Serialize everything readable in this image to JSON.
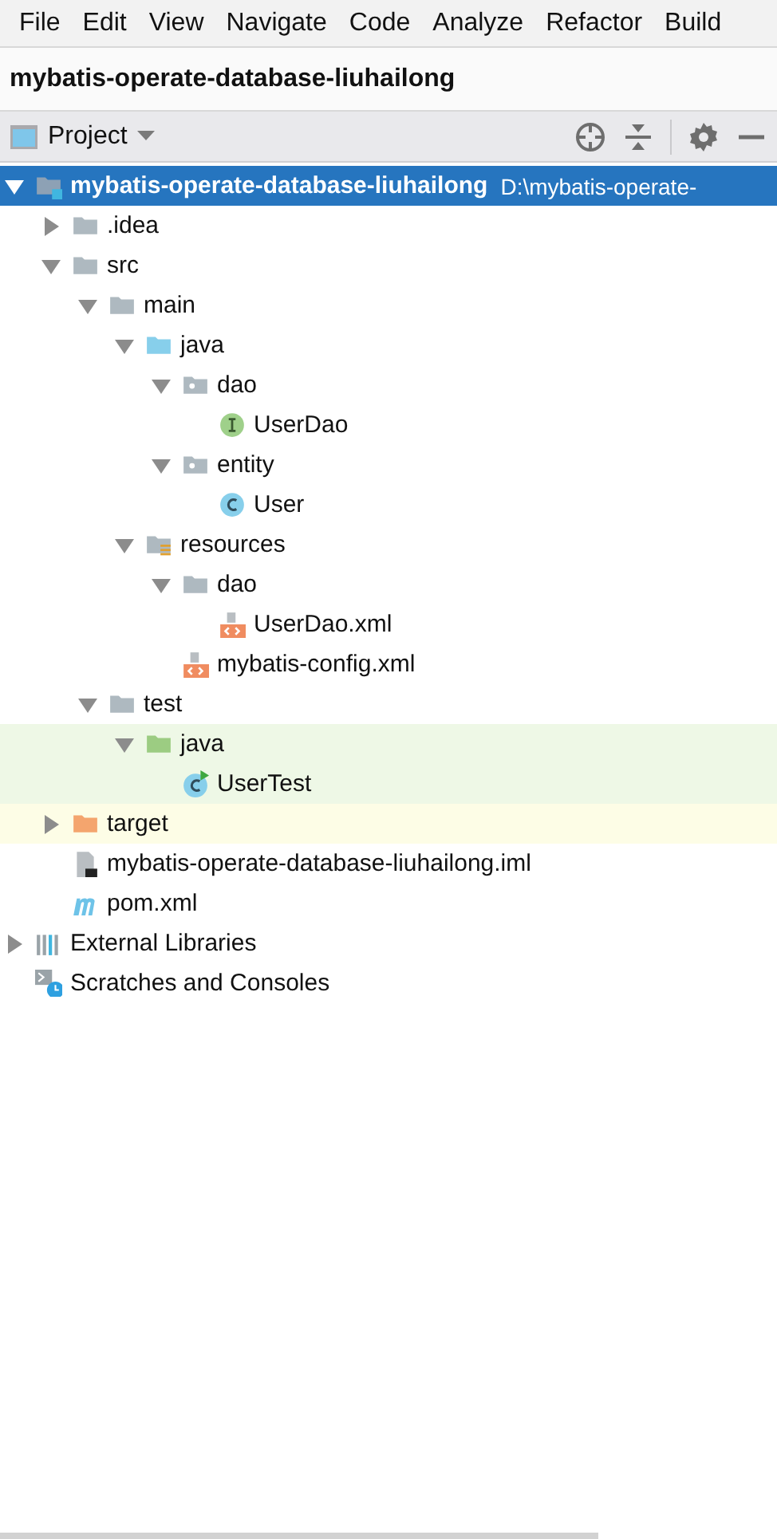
{
  "menu_bar": {
    "items": [
      "File",
      "Edit",
      "View",
      "Navigate",
      "Code",
      "Analyze",
      "Refactor",
      "Build"
    ]
  },
  "breadcrumb": {
    "title": "mybatis-operate-database-liuhailong"
  },
  "tool_window": {
    "title": "Project"
  },
  "tree": [
    {
      "label": "mybatis-operate-database-liuhailong",
      "hint": "D:\\mybatis-operate-",
      "kind": "project",
      "expanded": true,
      "selected": true,
      "children": [
        {
          "label": ".idea",
          "kind": "folder",
          "expanded": false,
          "selected": false
        },
        {
          "label": "src",
          "kind": "folder",
          "expanded": true,
          "selected": false,
          "children": [
            {
              "label": "main",
              "kind": "folder",
              "expanded": true,
              "selected": false,
              "children": [
                {
                  "label": "java",
                  "kind": "source",
                  "expanded": true,
                  "selected": false,
                  "children": [
                    {
                      "label": "dao",
                      "kind": "package",
                      "expanded": true,
                      "selected": false,
                      "children": [
                        {
                          "label": "UserDao",
                          "kind": "interface",
                          "selected": false
                        }
                      ]
                    },
                    {
                      "label": "entity",
                      "kind": "package",
                      "expanded": true,
                      "selected": false,
                      "children": [
                        {
                          "label": "User",
                          "kind": "class",
                          "selected": false
                        }
                      ]
                    }
                  ]
                },
                {
                  "label": "resources",
                  "kind": "resources",
                  "expanded": true,
                  "selected": false,
                  "children": [
                    {
                      "label": "dao",
                      "kind": "folder",
                      "expanded": true,
                      "selected": false,
                      "children": [
                        {
                          "label": "UserDao.xml",
                          "kind": "xml",
                          "selected": false
                        }
                      ]
                    },
                    {
                      "label": "mybatis-config.xml",
                      "kind": "xml",
                      "selected": false
                    }
                  ]
                }
              ]
            },
            {
              "label": "test",
              "kind": "folder",
              "expanded": true,
              "selected": false,
              "children": [
                {
                  "label": "java",
                  "kind": "test",
                  "expanded": true,
                  "selected": false,
                  "color": "#eef8e6",
                  "children": [
                    {
                      "label": "UserTest",
                      "kind": "testclass",
                      "selected": false,
                      "color": "#eef8e6"
                    }
                  ]
                }
              ]
            }
          ]
        },
        {
          "label": "target",
          "kind": "excluded",
          "expanded": false,
          "selected": false,
          "color": "#fdfde6"
        },
        {
          "label": "mybatis-operate-database-liuhailong.iml",
          "kind": "iml",
          "selected": false
        },
        {
          "label": "pom.xml",
          "kind": "maven",
          "selected": false
        }
      ]
    },
    {
      "label": "External Libraries",
      "kind": "libraries",
      "expanded": false,
      "selected": false
    },
    {
      "label": "Scratches and Consoles",
      "kind": "scratches",
      "selected": false
    }
  ]
}
